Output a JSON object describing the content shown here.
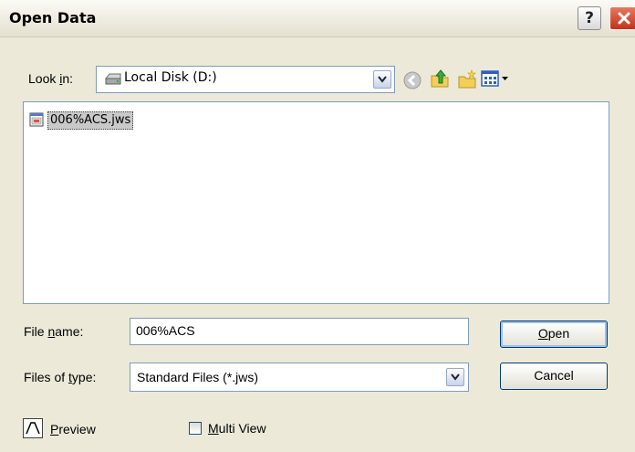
{
  "window": {
    "title": "Open Data",
    "help_label": "?"
  },
  "look_in": {
    "label_pre": "Look ",
    "label_key": "i",
    "label_post": "n:",
    "value": "Local Disk (D:)",
    "drive_icon": "hard-drive-icon"
  },
  "toolbar": {
    "icons": [
      "back-icon",
      "up-folder-icon",
      "new-folder-icon",
      "view-menu-icon"
    ]
  },
  "files": [
    {
      "name": "006%ACS.jws",
      "icon": "document-icon",
      "selected": true
    }
  ],
  "filename": {
    "label_pre": "File ",
    "label_key": "n",
    "label_post": "ame:",
    "value": "006%ACS"
  },
  "filetype": {
    "label_pre": "Files of ",
    "label_key": "t",
    "label_post": "ype:",
    "value": "Standard Files (*.jws)"
  },
  "buttons": {
    "open_key": "O",
    "open_rest": "pen",
    "cancel": "Cancel"
  },
  "options": {
    "preview_key": "P",
    "preview_rest": "review",
    "multiview_key": "M",
    "multiview_rest": "ulti View",
    "multiview_checked": false
  },
  "colors": {
    "title_bg": "#e4e0cf",
    "close_bg": "#c0331a",
    "dialog_bg": "#ece9d8",
    "selection": "#c9c9c9"
  }
}
